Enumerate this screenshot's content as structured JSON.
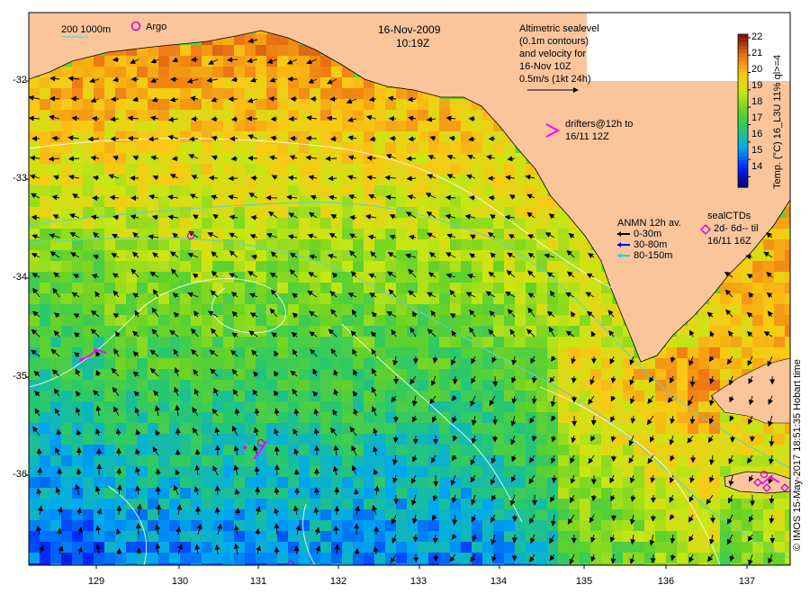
{
  "map": {
    "date": "16-Nov-2009",
    "time": "10:19Z",
    "lat_ticks": [
      "-32",
      "-33",
      "-34",
      "-35",
      "-36"
    ],
    "lon_ticks": [
      "129",
      "130",
      "131",
      "132",
      "133",
      "134",
      "135",
      "136",
      "137"
    ],
    "lon_range": [
      128.2,
      137.5
    ],
    "lat_range": [
      -36.9,
      -31.3
    ]
  },
  "legend": {
    "isobaths": "200  1000m",
    "argo": "Argo",
    "altimetry": [
      "Altimetric sealevel",
      "(0.1m contours)",
      "and velocity for",
      "16-Nov 10Z",
      "0.5m/s (1kt 24h)"
    ],
    "drifters": [
      "drifters@12h to",
      "16/11 12Z"
    ],
    "anmn_title": "ANMN 12h av.",
    "anmn_items": [
      {
        "label": "0-30m",
        "color": "#000000"
      },
      {
        "label": "30-80m",
        "color": "#0000ff"
      },
      {
        "label": "80-150m",
        "color": "#00e0e0"
      }
    ],
    "seal": [
      "sealCTDs",
      "2d- 6d-- til",
      "16/11 16Z"
    ]
  },
  "colorbar": {
    "ticks": [
      "22",
      "21",
      "20",
      "19",
      "18",
      "17",
      "16",
      "15",
      "14"
    ],
    "label": "Temp. (°C) 16_L3U 11% ql>=4",
    "range": [
      13.4,
      22.2
    ]
  },
  "credit": "© IMOS 15-May-2017 18:51:35 Hobart time",
  "colors": {
    "land": "#fbc59c",
    "argo": "#cc00cc",
    "drifter": "#ff00ff",
    "isobath": "#5fd0d0",
    "contour": "#ffffff"
  }
}
